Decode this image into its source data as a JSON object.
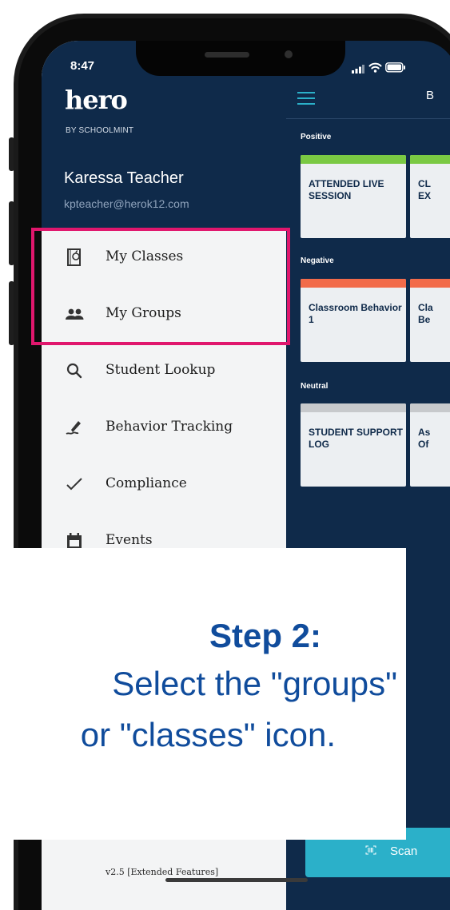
{
  "status_bar": {
    "time": "8:47"
  },
  "brand": {
    "logo_text": "hero",
    "logo_sub": "BY SCHOOLMINT"
  },
  "user": {
    "name": "Karessa Teacher",
    "email": "kpteacher@herok12.com"
  },
  "menu": {
    "items": [
      {
        "label": "My Classes",
        "icon": "classes-apple-icon"
      },
      {
        "label": "My Groups",
        "icon": "groups-icon"
      },
      {
        "label": "Student Lookup",
        "icon": "search-icon"
      },
      {
        "label": "Behavior Tracking",
        "icon": "behavior-pen-icon"
      },
      {
        "label": "Compliance",
        "icon": "checkmark-icon"
      },
      {
        "label": "Events",
        "icon": "calendar-icon"
      }
    ]
  },
  "version": "v2.5 [Extended Features]",
  "content": {
    "header_partial": "B",
    "categories": [
      {
        "label": "Positive",
        "color": "#7ac943",
        "cards": [
          "ATTENDED LIVE SESSION",
          "CL EX"
        ]
      },
      {
        "label": "Negative",
        "color": "#f26b4a",
        "cards": [
          "Classroom Behavior 1",
          "Cla Be"
        ]
      },
      {
        "label": "Neutral",
        "color": "#c7c9cc",
        "cards": [
          "STUDENT SUPPORT LOG",
          "As Of"
        ]
      }
    ],
    "scan_label": "Scan"
  },
  "instruction": {
    "step": "Step 2:",
    "line1": "Select the \"groups\"",
    "line2": "or \"classes\" icon."
  },
  "colors": {
    "navy": "#0f2a4a",
    "accent": "#2bb0c9",
    "highlight": "#e0176d",
    "step_text": "#104c9c"
  }
}
